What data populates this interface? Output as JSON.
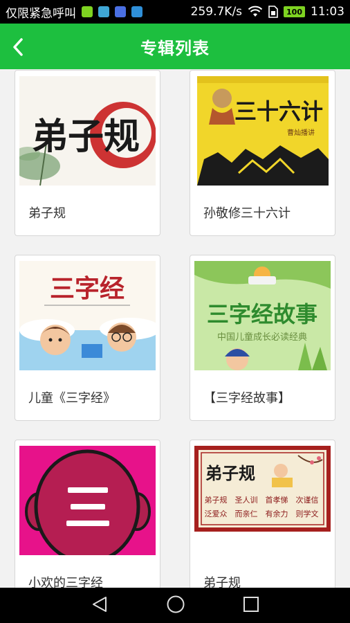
{
  "status_bar": {
    "carrier": "仅限紧急呼叫",
    "network_speed": "259.7K/s",
    "battery": "100",
    "time": "11:03"
  },
  "app_bar": {
    "title": "专辑列表",
    "back_icon": "chevron-left-icon"
  },
  "albums": [
    {
      "title": "弟子规",
      "cover_text": "弟子规"
    },
    {
      "title": "孙敬修三十六计",
      "cover_text": "三十六计",
      "cover_caption": "曹灿播讲"
    },
    {
      "title": "儿童《三字经》",
      "cover_text": "三字经"
    },
    {
      "title": "【三字经故事】",
      "cover_text": "三字经故事",
      "cover_caption": "中国儿童成长必读经典"
    },
    {
      "title": "小欢的三字经",
      "cover_text": "三"
    },
    {
      "title": "弟子规",
      "cover_text": "弟子规",
      "cover_words": [
        "弟子规",
        "圣人训",
        "首孝悌",
        "次谨信",
        "泛爱众",
        "而亲仁",
        "有余力",
        "则学文"
      ]
    }
  ],
  "nav_bar": {
    "back": "triangle-back-icon",
    "home": "circle-home-icon",
    "recents": "square-recents-icon"
  },
  "colors": {
    "accent": "#1dbf3f",
    "status_bg": "#000000",
    "card_border": "#d6d6d6"
  }
}
